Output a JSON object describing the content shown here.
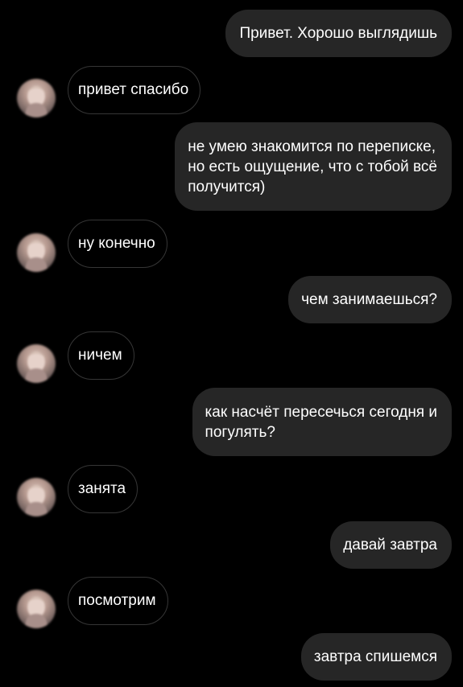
{
  "chat": {
    "avatar_icon": "contact-avatar-photo",
    "messages": [
      {
        "side": "sent",
        "text": "Привет. Хорошо выглядишь"
      },
      {
        "side": "received",
        "text": "привет спасибо"
      },
      {
        "side": "sent",
        "text": "не умею знакомится по переписке,\nно есть ощущение, что с тобой всё\nполучится)"
      },
      {
        "side": "received",
        "text": "ну конечно"
      },
      {
        "side": "sent",
        "text": "чем занимаешься?"
      },
      {
        "side": "received",
        "text": "ничем"
      },
      {
        "side": "sent",
        "text": "как насчёт пересечься сегодня и\nпогулять?"
      },
      {
        "side": "received",
        "text": "занята"
      },
      {
        "side": "sent",
        "text": "давай завтра"
      },
      {
        "side": "received",
        "text": "посмотрим"
      },
      {
        "side": "sent",
        "text": "завтра спишемся"
      }
    ]
  },
  "colors": {
    "background": "#000000",
    "sent_bubble": "#262626",
    "received_border": "#363636",
    "text": "#ffffff"
  }
}
